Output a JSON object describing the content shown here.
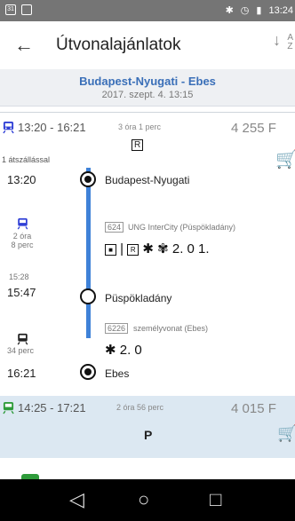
{
  "status": {
    "time": "13:24",
    "icons": [
      "sim-icon",
      "image-icon",
      "bluetooth-icon",
      "alarm-icon",
      "battery-icon"
    ]
  },
  "appbar": {
    "title": "Útvonalajánlatok",
    "sort_top": "A",
    "sort_bottom": "Z"
  },
  "route": {
    "name": "Budapest-Nyugati - Ebes",
    "date": "2017. szept. 4. 13:15"
  },
  "journey1": {
    "time_range": "13:20 - 16:21",
    "duration": "3 óra 1 perc",
    "price": "4 255 F",
    "transfers": "1 átszállással",
    "reservation_badge": "R",
    "leg1": {
      "depart_time": "13:20",
      "station": "Budapest-Nyugati",
      "duration": "2 óra\n8 perc",
      "train_no": "624",
      "train_name": "UNG InterCity (Püspökladány)",
      "symbols": "2. 0 1."
    },
    "transfer": {
      "arrive_time": "15:28",
      "depart_time": "15:47",
      "station": "Püspökladány"
    },
    "leg2": {
      "duration": "34 perc",
      "train_no": "6226",
      "train_name": "személyvonat (Ebes)",
      "symbols": "2. 0"
    },
    "end": {
      "time": "16:21",
      "station": "Ebes"
    }
  },
  "journey2": {
    "time_range": "14:25 - 17:21",
    "duration": "2 óra 56 perc",
    "price": "4 015 F",
    "badge": "P"
  },
  "colors": {
    "accent": "#3f82d8",
    "train_icon": "#2f3fd6",
    "green_train": "#2e9b3a"
  }
}
